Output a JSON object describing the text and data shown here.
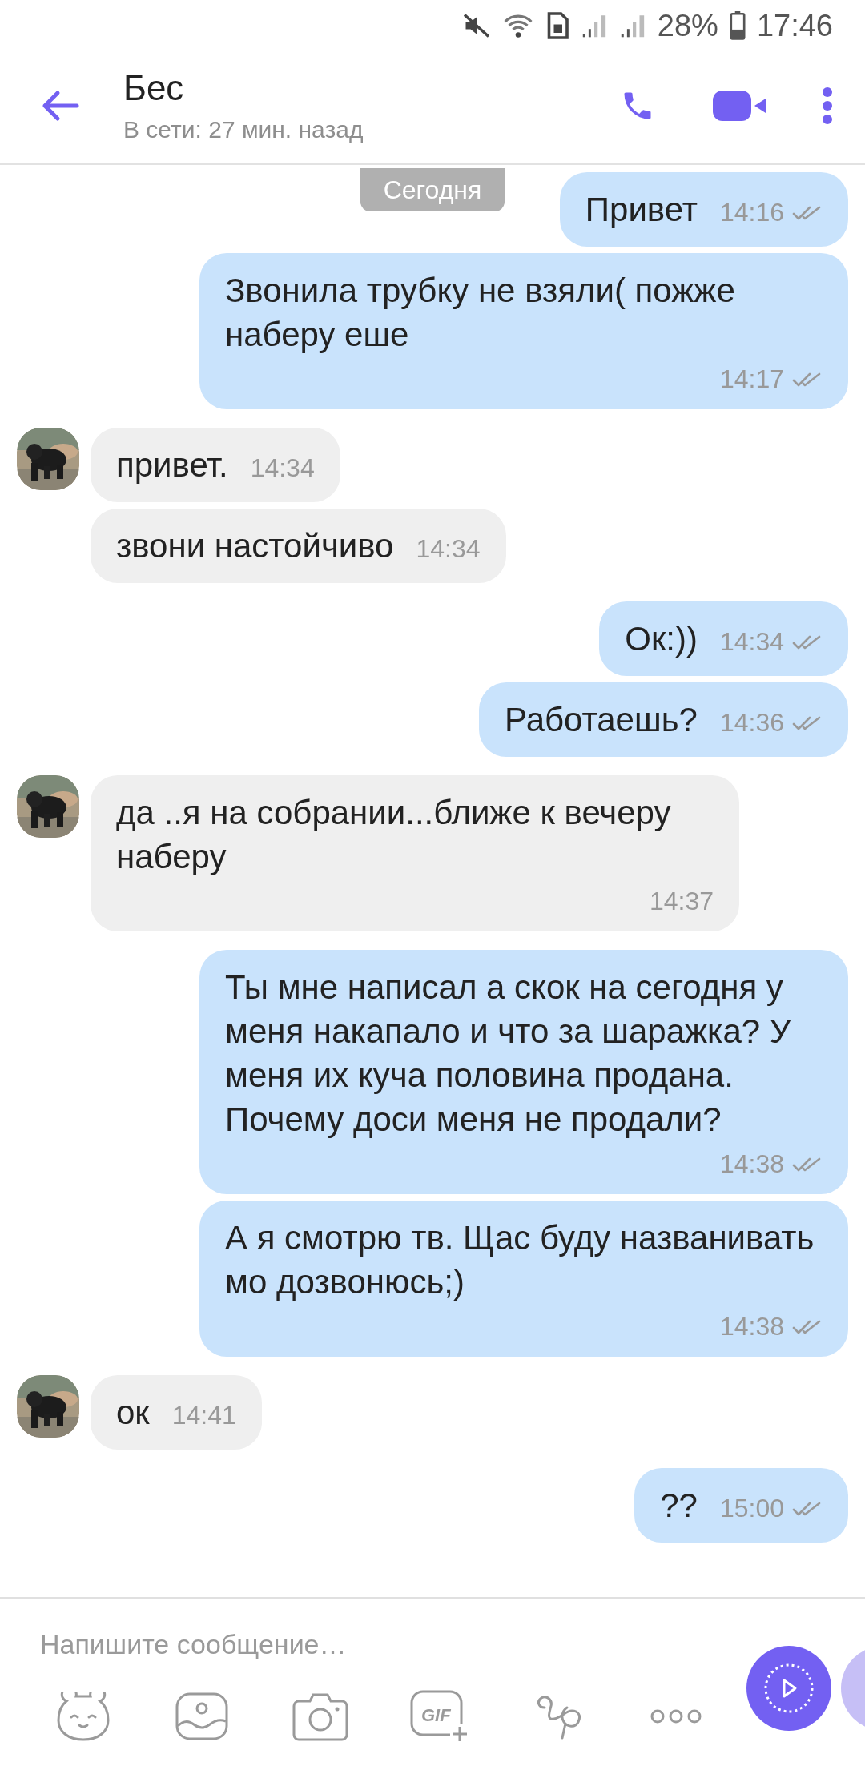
{
  "status_bar": {
    "battery": "28%",
    "time": "17:46"
  },
  "header": {
    "title": "Бес",
    "subtitle": "В сети: 27 мин. назад"
  },
  "date_pill": "Сегодня",
  "messages": [
    {
      "kind": "out",
      "text": "Привет",
      "time": "14:16"
    },
    {
      "kind": "out",
      "text": "Звонила трубку не взяли( пожже наберу еше",
      "time": "14:17"
    },
    {
      "kind": "in",
      "text": "привет.",
      "time": "14:34"
    },
    {
      "kind": "in",
      "text": "звони настойчиво",
      "time": "14:34"
    },
    {
      "kind": "out",
      "text": "Ок:))",
      "time": "14:34"
    },
    {
      "kind": "out",
      "text": "Работаешь?",
      "time": "14:36"
    },
    {
      "kind": "in",
      "text": "да ..я на собрании...ближе к вечеру наберу",
      "time": "14:37"
    },
    {
      "kind": "out",
      "text": "Ты мне написал а скок на сегодня у меня накапало и что за шаражка? У меня их куча половина продана. Почему доси меня не продали?",
      "time": "14:38"
    },
    {
      "kind": "out",
      "text": "А я смотрю тв. Щас буду названивать мо дозвонюсь;)",
      "time": "14:38"
    },
    {
      "kind": "in",
      "text": "ок",
      "time": "14:41"
    },
    {
      "kind": "out",
      "text": "??",
      "time": "15:00"
    }
  ],
  "composer": {
    "placeholder": "Напишите сообщение…",
    "gif_label": "GIF"
  }
}
